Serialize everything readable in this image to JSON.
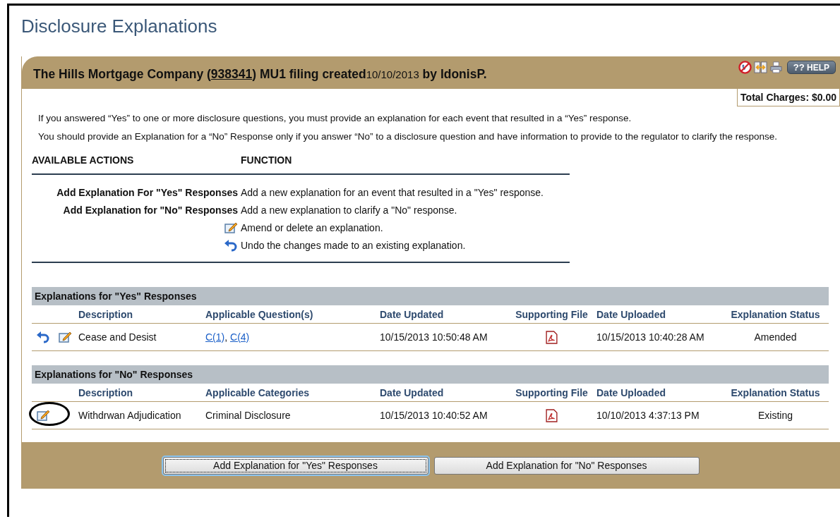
{
  "page_title": "Disclosure Explanations",
  "header": {
    "lead": "The Hills Mortgage Company (",
    "filing_id": "938341",
    "middle": ") MU1 filing created",
    "date": "10/10/2013",
    "tail": " by IdonisP."
  },
  "help_button": {
    "glyph": "??",
    "label": "HELP"
  },
  "total_charges": "Total Charges: $0.00",
  "intro": [
    "If you answered “Yes” to one or more disclosure questions, you must provide an explanation for each event that resulted in a “Yes” response.",
    "You should provide an Explanation for a “No” Response only if you answer “No” to a disclosure question and have information to provide to the regulator to clarify the response."
  ],
  "actions": {
    "headings": [
      "AVAILABLE ACTIONS",
      "FUNCTION"
    ],
    "rows": [
      {
        "kind": "text",
        "action": "Add Explanation For \"Yes\" Responses",
        "function": "Add a new explanation for an event that resulted in a \"Yes\" response."
      },
      {
        "kind": "text",
        "action": "Add Explanation for \"No\" Responses",
        "function": "Add a new explanation to clarify a \"No\" response."
      },
      {
        "kind": "edit",
        "function": "Amend or delete an explanation."
      },
      {
        "kind": "undo",
        "function": "Undo the changes made to an existing explanation."
      }
    ]
  },
  "sections": [
    {
      "title": "Explanations for \"Yes\" Responses",
      "columns": [
        "Description",
        "Applicable Question(s)",
        "Date Updated",
        "Supporting File",
        "Date Uploaded",
        "Explanation Status"
      ],
      "rows": [
        {
          "tools": [
            {
              "kind": "undo",
              "circled": false
            },
            {
              "kind": "edit",
              "circled": false
            }
          ],
          "description": "Cease and Desist",
          "links": [
            "C(1)",
            "C(4)"
          ],
          "link_separator": ", ",
          "date_updated": "10/15/2013 10:50:48 AM",
          "date_uploaded": "10/15/2013 10:40:28 AM",
          "status": "Amended"
        }
      ]
    },
    {
      "title": "Explanations for \"No\" Responses",
      "columns": [
        "Description",
        "Applicable Categories",
        "Date Updated",
        "Supporting File",
        "Date Uploaded",
        "Explanation Status"
      ],
      "rows": [
        {
          "tools": [
            {
              "kind": "edit",
              "circled": true
            }
          ],
          "description": "Withdrwan Adjudication",
          "category": "Criminal Disclosure",
          "date_updated": "10/15/2013 10:40:52 AM",
          "date_uploaded": "10/10/2013 4:37:13 PM",
          "status": "Existing"
        }
      ]
    }
  ],
  "buttons": [
    {
      "label": "Add Explanation for \"Yes\" Responses",
      "focused": true
    },
    {
      "label": "Add Explanation for \"No\" Responses",
      "focused": false
    }
  ]
}
